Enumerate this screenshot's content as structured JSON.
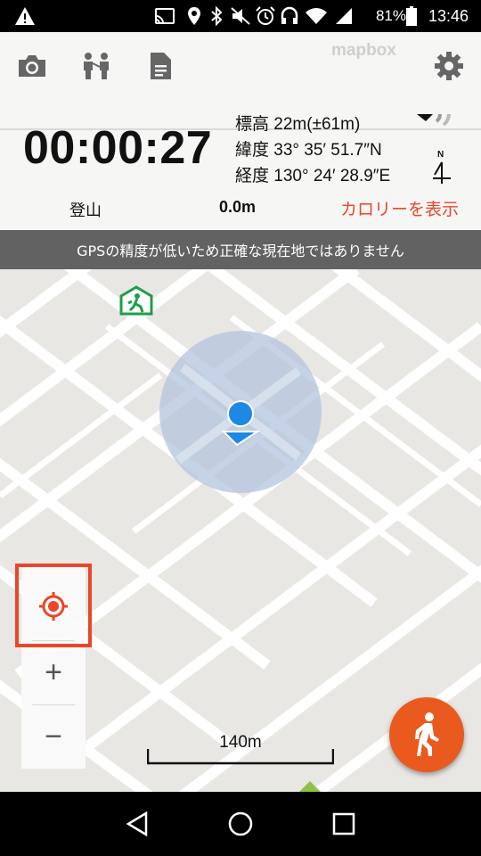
{
  "status_bar": {
    "battery_text": "81%",
    "time": "13:46",
    "icons": [
      "warning-icon",
      "cast-icon",
      "location-icon",
      "bluetooth-icon",
      "vibrate-off-icon",
      "alarm-icon",
      "headset-icon",
      "wifi-icon",
      "signal-icon",
      "battery-icon"
    ]
  },
  "toolbar": {
    "icons": [
      "camera-icon",
      "people-icon",
      "document-icon",
      "gear-icon"
    ]
  },
  "map_attribution": "mapbox",
  "tracking": {
    "elapsed": "00:00:27",
    "altitude": "標高 22m(±61m)",
    "latitude": "緯度 33° 35′ 51.7″N",
    "longitude": "経度 130° 24′ 28.9″E",
    "compass_label": "N",
    "activity_mode": "登山",
    "distance": "0.0m",
    "calories_link": "カロリーを表示"
  },
  "gps_warning": "GPSの精度が低いため正確な現在地ではありません",
  "map_controls": {
    "locate_icon": "locate-icon",
    "zoom_in": "+",
    "zoom_out": "−"
  },
  "scale_bar": "140m",
  "fab_icon": "walking-person-icon",
  "nav_bar": {
    "icons": [
      "back-icon",
      "home-icon",
      "recents-icon"
    ]
  },
  "colors": {
    "accent": "#e8472a",
    "fab": "#ea5a1f",
    "gps_banner": "#626262",
    "location_dot": "#1e88e5",
    "accuracy_circle": "#b3c4de"
  }
}
